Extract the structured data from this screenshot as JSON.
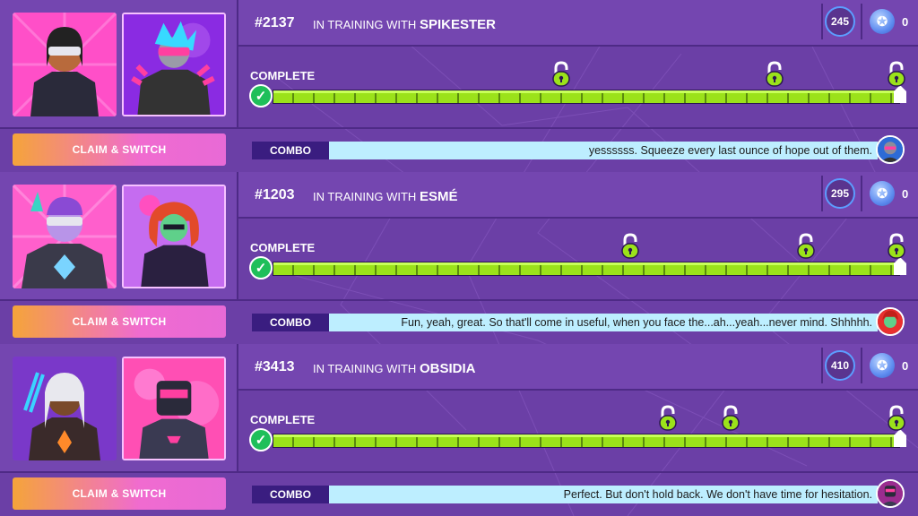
{
  "entries": [
    {
      "id": "#2137",
      "training_prefix": "IN TRAINING WITH",
      "trainer": "SPIKESTER",
      "score": "245",
      "gems": "0",
      "complete_label": "COMPLETE",
      "progress": 1.0,
      "unlock_points": [
        0.46,
        0.8,
        1.0
      ],
      "claim_label": "CLAIM & SWITCH",
      "combo_label": "COMBO",
      "combo_message": "yessssss. Squeeze every last ounce of hope out of them.",
      "colors": {
        "p1_bg": "#ff4fc8",
        "p2_bg": "#8a2be2",
        "avatar": "#2d6bd6"
      }
    },
    {
      "id": "#1203",
      "training_prefix": "IN TRAINING WITH",
      "trainer": "ESMÉ",
      "score": "295",
      "gems": "0",
      "complete_label": "COMPLETE",
      "progress": 1.0,
      "unlock_points": [
        0.57,
        0.85,
        1.0
      ],
      "claim_label": "CLAIM & SWITCH",
      "combo_label": "COMBO",
      "combo_message": "Fun, yeah, great. So that'll come in useful, when you face the...ah...yeah...never mind. Shhhhh.",
      "colors": {
        "p1_bg": "#ff5fcc",
        "p2_bg": "#c56cf0",
        "avatar": "#e8302f"
      }
    },
    {
      "id": "#3413",
      "training_prefix": "IN TRAINING WITH",
      "trainer": "OBSIDIA",
      "score": "410",
      "gems": "0",
      "complete_label": "COMPLETE",
      "progress": 1.0,
      "unlock_points": [
        0.63,
        0.73,
        1.0
      ],
      "claim_label": "CLAIM & SWITCH",
      "combo_label": "COMBO",
      "combo_message": "Perfect. But don't hold back. We don't have time for hesitation.",
      "colors": {
        "p1_bg": "#7a38c9",
        "p2_bg": "#ff4fb4",
        "avatar": "#9b2c8f"
      }
    }
  ]
}
